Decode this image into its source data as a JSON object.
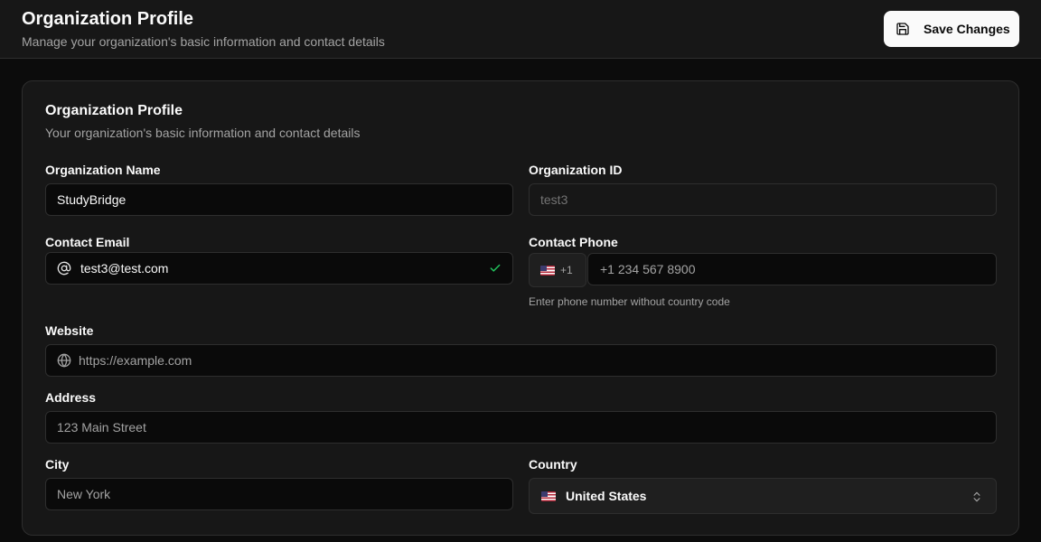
{
  "header": {
    "title": "Organization Profile",
    "subtitle": "Manage your organization's basic information and contact details",
    "save_label": "Save Changes"
  },
  "card": {
    "title": "Organization Profile",
    "subtitle": "Your organization's basic information and contact details"
  },
  "form": {
    "org_name": {
      "label": "Organization Name",
      "value": "StudyBridge"
    },
    "org_id": {
      "label": "Organization ID",
      "value": "test3"
    },
    "email": {
      "label": "Contact Email",
      "value": "test3@test.com",
      "icon": "at-icon",
      "status_icon": "check-icon"
    },
    "phone": {
      "label": "Contact Phone",
      "country_code": "+1",
      "placeholder": "+1 234 567 8900",
      "hint": "Enter phone number without country code",
      "flag_icon": "us-flag-icon"
    },
    "website": {
      "label": "Website",
      "placeholder": "https://example.com",
      "icon": "globe-icon"
    },
    "address": {
      "label": "Address",
      "placeholder": "123 Main Street"
    },
    "city": {
      "label": "City",
      "placeholder": "New York"
    },
    "country": {
      "label": "Country",
      "selected": "United States",
      "flag_icon": "us-flag-icon",
      "chevron_icon": "chevron-up-down-icon"
    }
  },
  "colors": {
    "background": "#0c0c0c",
    "surface": "#171717",
    "border": "#2e2e2e",
    "primary_button": "#fafafa",
    "success": "#22c55e"
  }
}
